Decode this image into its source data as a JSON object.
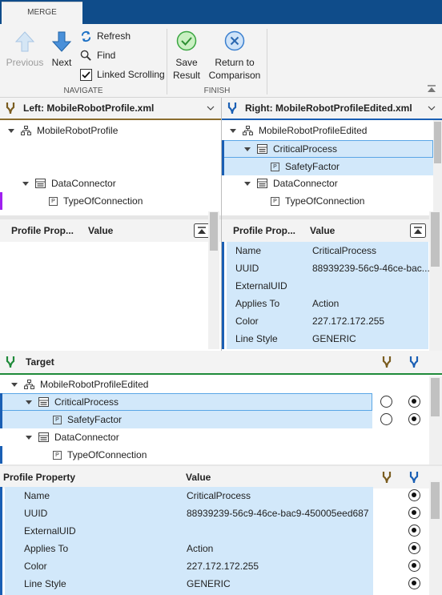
{
  "ribbon": {
    "tab": "MERGE",
    "previous": "Previous",
    "next": "Next",
    "refresh": "Refresh",
    "find": "Find",
    "linked_scrolling": "Linked Scrolling",
    "navigate": "NAVIGATE",
    "save_line1": "Save",
    "save_line2": "Result",
    "return_line1": "Return to",
    "return_line2": "Comparison",
    "finish": "FINISH"
  },
  "left": {
    "title": "Left: MobileRobotProfile.xml",
    "tree": [
      "MobileRobotProfile",
      "DataConnector",
      "TypeOfConnection"
    ],
    "col_prop": "Profile Prop...",
    "col_value": "Value"
  },
  "right": {
    "title": "Right: MobileRobotProfileEdited.xml",
    "tree": [
      "MobileRobotProfileEdited",
      "CriticalProcess",
      "SafetyFactor",
      "DataConnector",
      "TypeOfConnection"
    ],
    "col_prop": "Profile Prop...",
    "col_value": "Value",
    "props": [
      {
        "name": "Name",
        "value": "CriticalProcess"
      },
      {
        "name": "UUID",
        "value": "88939239-56c9-46ce-bac..."
      },
      {
        "name": "ExternalUID",
        "value": ""
      },
      {
        "name": "Applies To",
        "value": "Action"
      },
      {
        "name": "Color",
        "value": "227.172.172.255"
      },
      {
        "name": "Line Style",
        "value": "GENERIC"
      }
    ]
  },
  "target": {
    "title": "Target",
    "tree": [
      "MobileRobotProfileEdited",
      "CriticalProcess",
      "SafetyFactor",
      "DataConnector",
      "TypeOfConnection"
    ],
    "col_prop": "Profile Property",
    "col_value": "Value",
    "props": [
      {
        "name": "Name",
        "value": "CriticalProcess"
      },
      {
        "name": "UUID",
        "value": "88939239-56c9-46ce-bac9-450005eed687"
      },
      {
        "name": "ExternalUID",
        "value": ""
      },
      {
        "name": "Applies To",
        "value": "Action"
      },
      {
        "name": "Color",
        "value": "227.172.172.255"
      },
      {
        "name": "Line Style",
        "value": "GENERIC"
      }
    ]
  },
  "colors": {
    "left_accent": "#8a6d2e",
    "right_accent": "#1a5fb4",
    "target_accent": "#1f8a3a",
    "selection": "#d2e8fa",
    "missing_marker": "#a020f0"
  }
}
